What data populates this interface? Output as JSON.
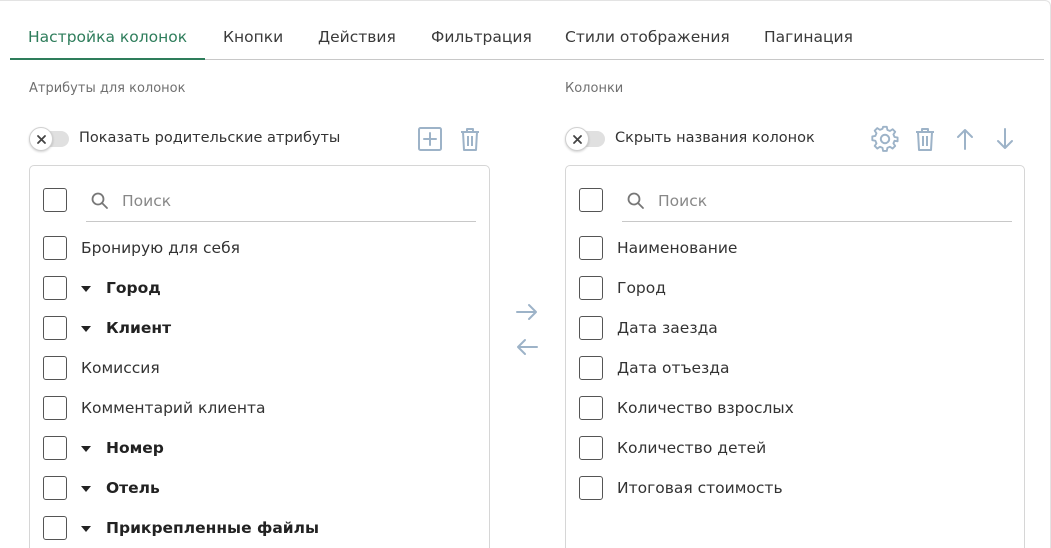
{
  "tabs": [
    {
      "label": "Настройка колонок",
      "active": true
    },
    {
      "label": "Кнопки",
      "active": false
    },
    {
      "label": "Действия",
      "active": false
    },
    {
      "label": "Фильтрация",
      "active": false
    },
    {
      "label": "Стили отображения",
      "active": false
    },
    {
      "label": "Пагинация",
      "active": false
    }
  ],
  "left": {
    "section_label": "Атрибуты для колонок",
    "toggle_label": "Показать родительские атрибуты",
    "toggle_on": false,
    "search_placeholder": "Поиск",
    "items": [
      {
        "label": "Бронирую для себя",
        "group": false
      },
      {
        "label": "Город",
        "group": true
      },
      {
        "label": "Клиент",
        "group": true
      },
      {
        "label": "Комиссия",
        "group": false
      },
      {
        "label": "Комментарий клиента",
        "group": false
      },
      {
        "label": "Номер",
        "group": true
      },
      {
        "label": "Отель",
        "group": true
      },
      {
        "label": "Прикрепленные файлы",
        "group": true
      }
    ]
  },
  "right": {
    "section_label": "Колонки",
    "toggle_label": "Скрыть названия колонок",
    "toggle_on": false,
    "search_placeholder": "Поиск",
    "items": [
      {
        "label": "Наименование"
      },
      {
        "label": "Город"
      },
      {
        "label": "Дата заезда"
      },
      {
        "label": "Дата отъезда"
      },
      {
        "label": "Количество взрослых"
      },
      {
        "label": "Количество детей"
      },
      {
        "label": "Итоговая стоимость"
      }
    ]
  },
  "colors": {
    "accent": "#2e7d5b",
    "icon_muted": "#9db3c8"
  }
}
